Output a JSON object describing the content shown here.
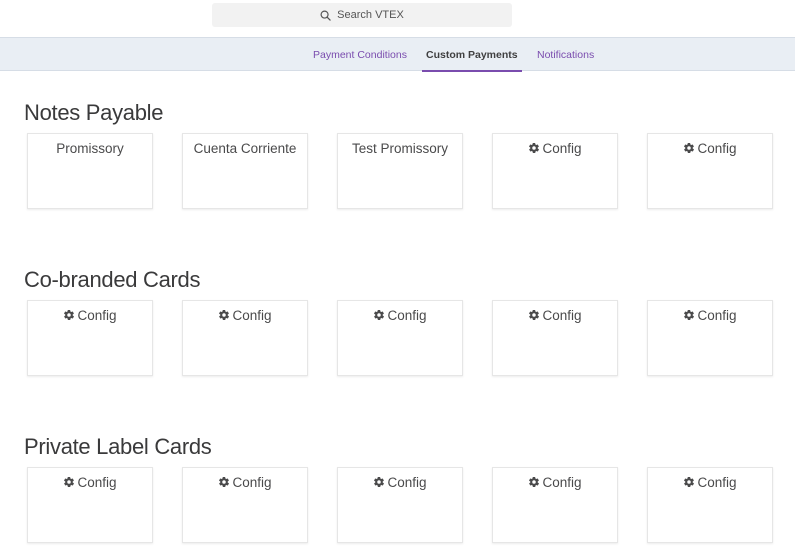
{
  "search": {
    "label": "Search VTEX"
  },
  "tabs": [
    {
      "label": "Payment Conditions",
      "active": false
    },
    {
      "label": "Custom Payments",
      "active": true
    },
    {
      "label": "Notifications",
      "active": false
    }
  ],
  "sections": [
    {
      "title": "Notes Payable",
      "cards": [
        {
          "label": "Promissory",
          "icon": ""
        },
        {
          "label": "Cuenta Corriente",
          "icon": ""
        },
        {
          "label": "Test Promissory",
          "icon": ""
        },
        {
          "label": "Config",
          "icon": "gear-icon"
        },
        {
          "label": "Config",
          "icon": "gear-icon"
        }
      ]
    },
    {
      "title": "Co-branded Cards",
      "cards": [
        {
          "label": "Config",
          "icon": "gear-icon"
        },
        {
          "label": "Config",
          "icon": "gear-icon"
        },
        {
          "label": "Config",
          "icon": "gear-icon"
        },
        {
          "label": "Config",
          "icon": "gear-icon"
        },
        {
          "label": "Config",
          "icon": "gear-icon"
        }
      ]
    },
    {
      "title": "Private Label Cards",
      "cards": [
        {
          "label": "Config",
          "icon": "gear-icon"
        },
        {
          "label": "Config",
          "icon": "gear-icon"
        },
        {
          "label": "Config",
          "icon": "gear-icon"
        },
        {
          "label": "Config",
          "icon": "gear-icon"
        },
        {
          "label": "Config",
          "icon": "gear-icon"
        }
      ]
    }
  ],
  "colors": {
    "accent": "#7a4cae",
    "tabbar_bg": "#e9eef4"
  }
}
